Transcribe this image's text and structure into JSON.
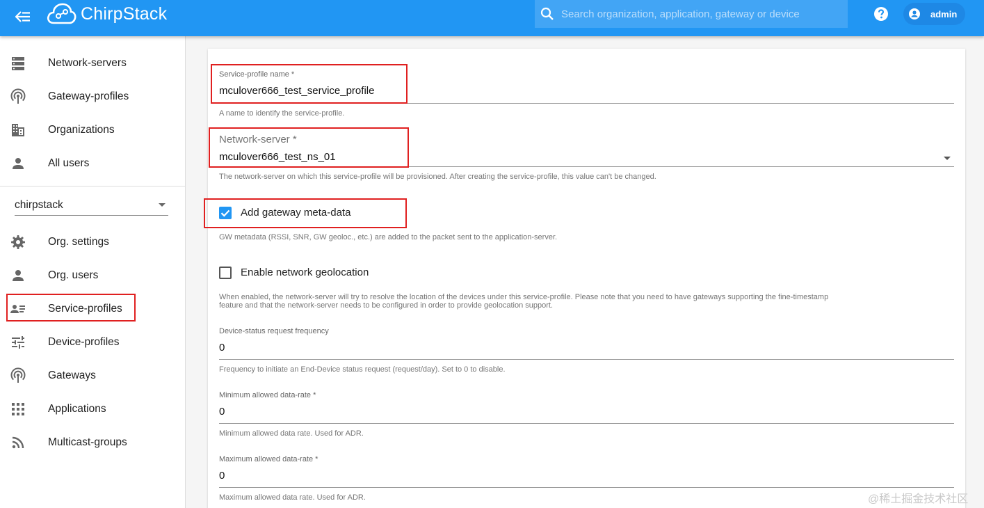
{
  "header": {
    "brand": "ChirpStack",
    "search_placeholder": "Search organization, application, gateway or device",
    "user": "admin",
    "colors": {
      "primary": "#2196f3",
      "search_bg": "#42a5f5"
    }
  },
  "sidebar": {
    "admin_items": [
      {
        "label": "Network-servers",
        "icon": "server-stack-icon"
      },
      {
        "label": "Gateway-profiles",
        "icon": "antenna-icon"
      },
      {
        "label": "Organizations",
        "icon": "building-icon"
      },
      {
        "label": "All users",
        "icon": "person-icon"
      }
    ],
    "org_selected": "chirpstack",
    "org_items": [
      {
        "label": "Org. settings",
        "icon": "gear-icon"
      },
      {
        "label": "Org. users",
        "icon": "person-icon"
      },
      {
        "label": "Service-profiles",
        "icon": "account-details-icon"
      },
      {
        "label": "Device-profiles",
        "icon": "tune-icon"
      },
      {
        "label": "Gateways",
        "icon": "antenna-icon"
      },
      {
        "label": "Applications",
        "icon": "apps-grid-icon"
      },
      {
        "label": "Multicast-groups",
        "icon": "rss-icon"
      }
    ]
  },
  "form": {
    "service_profile_name": {
      "label": "Service-profile name *",
      "value": "mculover666_test_service_profile",
      "helper": "A name to identify the service-profile."
    },
    "network_server": {
      "label": "Network-server *",
      "value": "mculover666_test_ns_01",
      "helper": "The network-server on which this service-profile will be provisioned. After creating the service-profile, this value can't be changed."
    },
    "add_gw_metadata": {
      "label": "Add gateway meta-data",
      "checked": true,
      "helper": "GW metadata (RSSI, SNR, GW geoloc., etc.) are added to the packet sent to the application-server."
    },
    "network_geolocation": {
      "label": "Enable network geolocation",
      "checked": false,
      "helper_line1": "When enabled, the network-server will try to resolve the location of the devices under this service-profile. Please note that you need to have gateways supporting the fine-timestamp",
      "helper_line2": "feature and that the network-server needs to be configured in order to provide geolocation support."
    },
    "dev_status_freq": {
      "label": "Device-status request frequency",
      "value": "0",
      "helper": "Frequency to initiate an End-Device status request (request/day). Set to 0 to disable."
    },
    "min_dr": {
      "label": "Minimum allowed data-rate *",
      "value": "0",
      "helper": "Minimum allowed data rate. Used for ADR."
    },
    "max_dr": {
      "label": "Maximum allowed data-rate *",
      "value": "0",
      "helper": "Maximum allowed data rate. Used for ADR."
    }
  },
  "watermark": "@稀土掘金技术社区"
}
